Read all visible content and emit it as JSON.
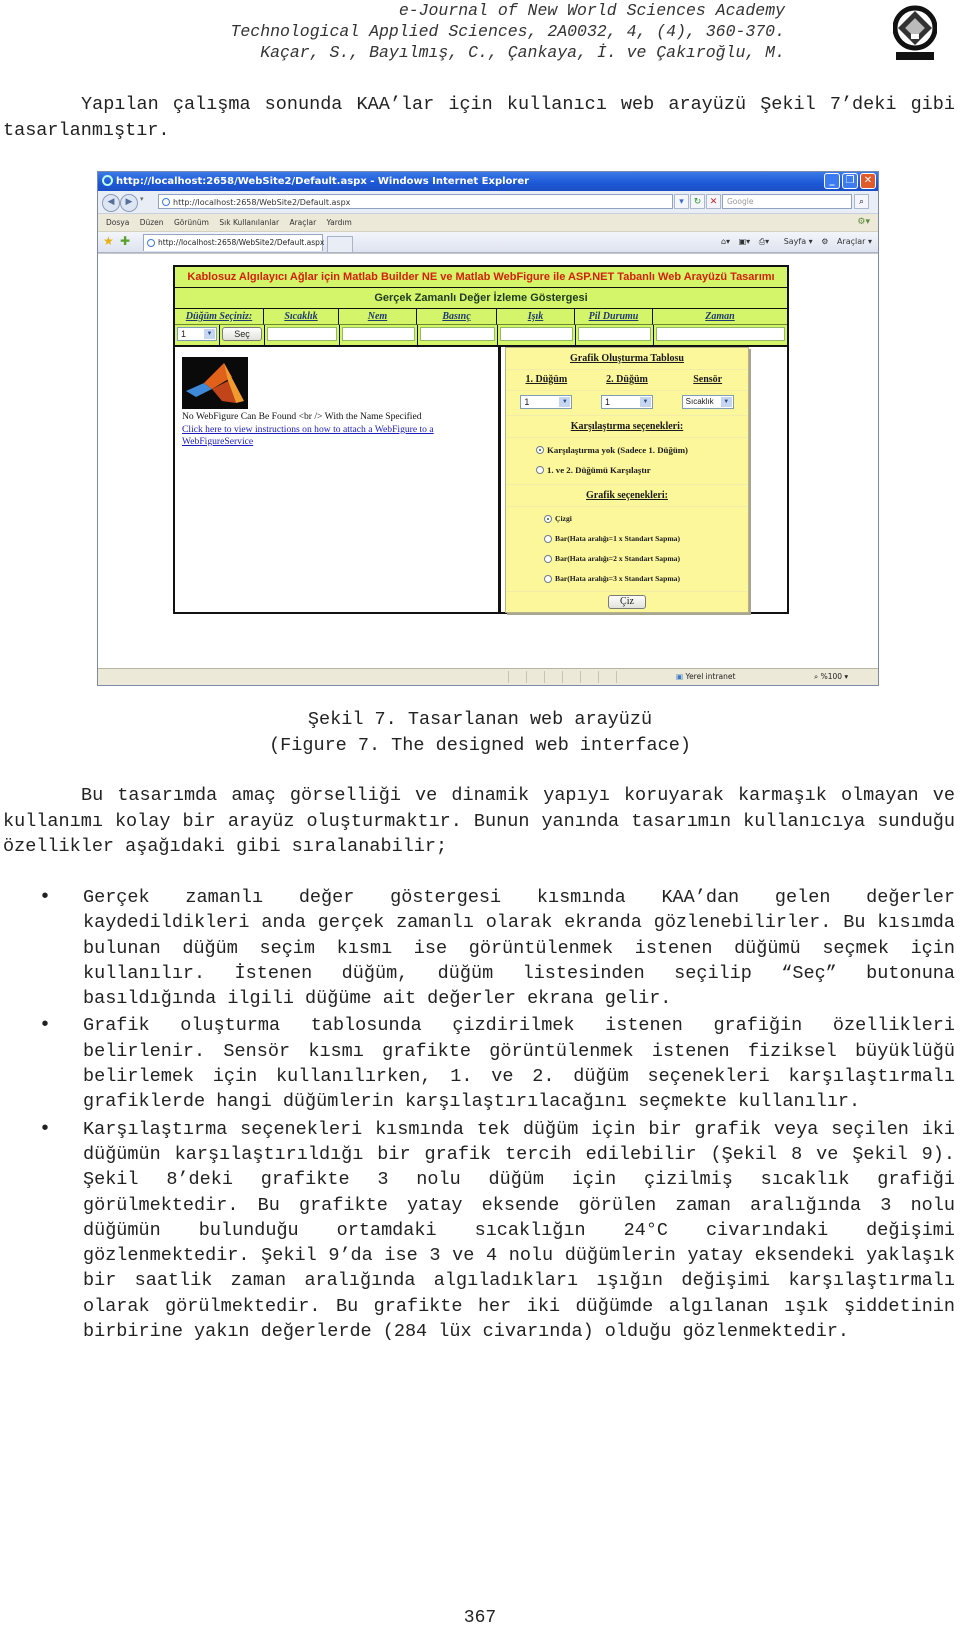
{
  "header": {
    "journal": "e-Journal of New World Sciences Academy",
    "citation": "Technological Applied Sciences, 2A0032, 4, (4), 360-370.",
    "authors": "Kaçar, S., Bayılmış, C., Çankaya, İ. ve Çakıroğlu, M.",
    "logo_alt": "NWSA logo"
  },
  "intro": "Yapılan çalışma sonunda KAA’lar için kullanıcı web arayüzü Şekil 7’deki gibi tasarlanmıştır.",
  "figure": {
    "browser": {
      "title": "http://localhost:2658/WebSite2/Default.aspx - Windows Internet Explorer",
      "address": "http://localhost:2658/WebSite2/Default.aspx",
      "search_placeholder": "Google",
      "menu": [
        "Dosya",
        "Düzen",
        "Görünüm",
        "Sık Kullanılanlar",
        "Araçlar",
        "Yardım"
      ],
      "tab_label": "http://localhost:2658/WebSite2/Default.aspx",
      "tools": [
        "Sayfa",
        "Araçlar"
      ],
      "status_zone": "Yerel intranet",
      "zoom": "%100"
    },
    "app": {
      "banner": "Kablosuz Algılayıcı Ağlar için Matlab Builder NE ve Matlab WebFigure ile ASP.NET Tabanlı Web Arayüzü Tasarımı",
      "realtime_title": "Gerçek Zamanlı Değer İzleme Göstergesi",
      "columns": [
        "Düğüm Seçiniz:",
        "Sıcaklık",
        "Nem",
        "Basınç",
        "Işık",
        "Pil Durumu",
        "Zaman"
      ],
      "node_select_value": "1",
      "select_button": "Seç",
      "webfigure_message": "No WebFigure Can Be Found <br /> With the Name Specified",
      "webfigure_link": "Click here to view instructions on how to attach a WebFigure to a WebFigureService",
      "graph_table": {
        "title": "Grafik Oluşturma Tablosu",
        "columns": [
          "1. Düğüm",
          "2. Düğüm",
          "Sensör"
        ],
        "node1_value": "1",
        "node2_value": "1",
        "sensor_value": "Sıcaklık",
        "compare_title": "Karşılaştırma seçenekleri:",
        "compare_options": [
          {
            "label": "Karşılaştırma yok (Sadece 1. Düğüm)",
            "selected": true
          },
          {
            "label": "1. ve 2. Düğümü Karşılaştır",
            "selected": false
          }
        ],
        "graph_title": "Grafik seçenekleri:",
        "graph_options": [
          {
            "label": "Çizgi",
            "selected": true
          },
          {
            "label": "Bar(Hata aralığı=1 x Standart Sapma)",
            "selected": false
          },
          {
            "label": "Bar(Hata aralığı=2 x Standart Sapma)",
            "selected": false
          },
          {
            "label": "Bar(Hata aralığı=3 x Standart Sapma)",
            "selected": false
          }
        ],
        "draw_button": "Çiz"
      }
    },
    "caption_tr": "Şekil 7. Tasarlanan web arayüzü",
    "caption_en": "(Figure 7. The designed web interface)"
  },
  "body_paragraph": "Bu tasarımda amaç görselliği ve dinamik yapıyı koruyarak karmaşık olmayan ve kullanımı kolay bir arayüz oluşturmaktır. Bunun yanında tasarımın kullanıcıya sunduğu özellikler aşağıdaki gibi sıralanabilir;",
  "bullets": [
    "Gerçek zamanlı değer göstergesi kısmında KAA’dan gelen değerler kaydedildikleri anda gerçek zamanlı olarak ekranda gözlenebilirler. Bu kısımda bulunan düğüm seçim kısmı ise görüntülenmek istenen düğümü seçmek için kullanılır. İstenen düğüm, düğüm listesinden seçilip “Seç” butonuna basıldığında ilgili düğüme ait değerler ekrana gelir.",
    "Grafik oluşturma tablosunda çizdirilmek istenen grafiğin özellikleri belirlenir. Sensör kısmı grafikte görüntülenmek istenen fiziksel büyüklüğü belirlemek için kullanılırken, 1. ve 2. düğüm seçenekleri karşılaştırmalı grafiklerde hangi düğümlerin karşılaştırılacağını seçmekte kullanılır.",
    "Karşılaştırma seçenekleri kısmında tek düğüm için bir grafik veya seçilen iki düğümün karşılaştırıldığı bir grafik tercih edilebilir (Şekil 8 ve Şekil 9). Şekil 8’deki grafikte 3 nolu düğüm için çizilmiş sıcaklık grafiği görülmektedir. Bu grafikte yatay eksende görülen zaman aralığında 3 nolu düğümün bulunduğu ortamdaki sıcaklığın 24°C civarındaki değişimi gözlenmektedir. Şekil 9’da ise 3 ve 4 nolu düğümlerin yatay eksendeki yaklaşık bir saatlik zaman aralığında algıladıkları ışığın değişimi karşılaştırmalı olarak görülmektedir. Bu grafikte her iki düğümde algılanan ışık şiddetinin birbirine yakın değerlerde (284 lüx civarında) olduğu gözlenmektedir."
  ],
  "page_number": "367"
}
